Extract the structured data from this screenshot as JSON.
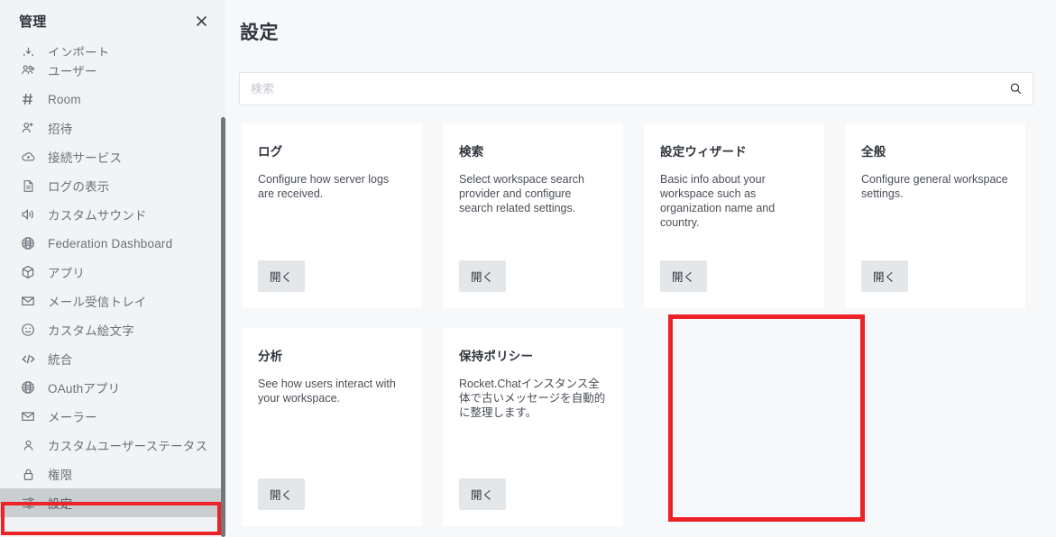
{
  "colors": {
    "annotation": "#ec2227",
    "sidebar_bg": "#f2f3f5",
    "main_bg": "#f7f8fa",
    "card_bg": "#ffffff",
    "button_bg": "#e4e7ea",
    "selected_item_bg": "#cbced1",
    "text_primary": "#2f343d",
    "text_muted": "#6c727a",
    "scrollbar": "#747678"
  },
  "sidebar": {
    "title": "管理",
    "close_label": "×",
    "items": [
      {
        "label": "インポート",
        "icon": "import-icon",
        "selected": false,
        "clipped": true
      },
      {
        "label": "ユーザー",
        "icon": "users-icon",
        "selected": false
      },
      {
        "label": "Room",
        "icon": "hash-icon",
        "selected": false
      },
      {
        "label": "招待",
        "icon": "user-plus-icon",
        "selected": false
      },
      {
        "label": "接続サービス",
        "icon": "cloud-plus-icon",
        "selected": false
      },
      {
        "label": "ログの表示",
        "icon": "document-icon",
        "selected": false
      },
      {
        "label": "カスタムサウンド",
        "icon": "speaker-icon",
        "selected": false
      },
      {
        "label": "Federation Dashboard",
        "icon": "globe-icon",
        "selected": false
      },
      {
        "label": "アプリ",
        "icon": "cube-icon",
        "selected": false
      },
      {
        "label": "メール受信トレイ",
        "icon": "envelope-icon",
        "selected": false
      },
      {
        "label": "カスタム絵文字",
        "icon": "smiley-icon",
        "selected": false
      },
      {
        "label": "統合",
        "icon": "code-icon",
        "selected": false
      },
      {
        "label": "OAuthアプリ",
        "icon": "globe-icon",
        "selected": false
      },
      {
        "label": "メーラー",
        "icon": "envelope-icon",
        "selected": false
      },
      {
        "label": "カスタムユーザーステータス",
        "icon": "person-icon",
        "selected": false
      },
      {
        "label": "権限",
        "icon": "lock-icon",
        "selected": false
      },
      {
        "label": "設定",
        "icon": "sliders-icon",
        "selected": true
      }
    ]
  },
  "main": {
    "page_title": "設定",
    "search": {
      "placeholder": "検索",
      "value": "",
      "icon": "search-icon"
    },
    "open_button_label": "開く",
    "cards": [
      {
        "title": "ログ",
        "description": "Configure how server logs are received.",
        "button": "開く",
        "highlighted": false,
        "row": 1
      },
      {
        "title": "検索",
        "description": "Select workspace search provider and configure search related settings.",
        "button": "開く",
        "highlighted": false,
        "row": 1
      },
      {
        "title": "設定ウィザード",
        "description": "Basic info about your workspace such as organization name and country.",
        "button": "開く",
        "highlighted": false,
        "row": 1
      },
      {
        "title": "全般",
        "description": "Configure general workspace settings.",
        "button": "開く",
        "highlighted": false,
        "row": 1
      },
      {
        "title": "分析",
        "description": "See how users interact with your workspace.",
        "button": "開く",
        "highlighted": false,
        "row": 2
      },
      {
        "title": "保持ポリシー",
        "description": "Rocket.Chatインスタンス全体で古いメッセージを自動的に整理します。",
        "button": "開く",
        "highlighted": true,
        "row": 2
      }
    ]
  }
}
